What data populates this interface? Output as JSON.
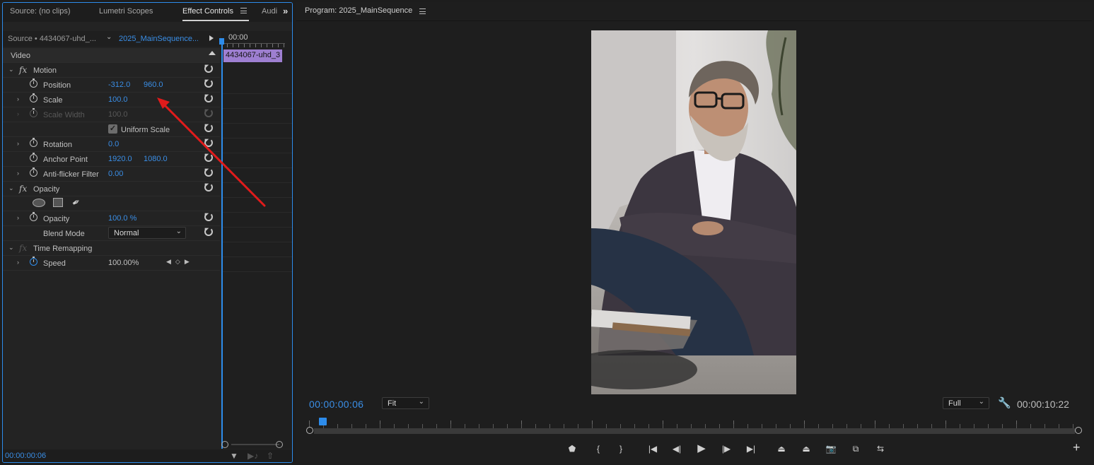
{
  "left_panel": {
    "tabs": [
      "Source: (no clips)",
      "Lumetri Scopes",
      "Effect Controls",
      "Audi"
    ],
    "active_tab": "Effect Controls",
    "source_label": "Source • 4434067-uhd_...",
    "sequence_link": "2025_MainSequence...",
    "timeline": {
      "time": "00:00",
      "clip_label": "4434067-uhd_3"
    },
    "section_video": "Video",
    "motion": {
      "label": "Motion",
      "position": {
        "label": "Position",
        "x": "-312.0",
        "y": "960.0"
      },
      "scale": {
        "label": "Scale",
        "value": "100.0"
      },
      "scale_width": {
        "label": "Scale Width",
        "value": "100.0"
      },
      "uniform_scale": {
        "label": "Uniform Scale",
        "checked": true
      },
      "rotation": {
        "label": "Rotation",
        "value": "0.0"
      },
      "anchor_point": {
        "label": "Anchor Point",
        "x": "1920.0",
        "y": "1080.0"
      },
      "anti_flicker": {
        "label": "Anti-flicker Filter",
        "value": "0.00"
      }
    },
    "opacity": {
      "label": "Opacity",
      "opacity_prop": {
        "label": "Opacity",
        "value": "100.0",
        "unit": "%"
      },
      "blend_mode": {
        "label": "Blend Mode",
        "value": "Normal"
      }
    },
    "time_remapping": {
      "label": "Time Remapping",
      "speed": {
        "label": "Speed",
        "value": "100.00%"
      }
    },
    "current_time": "00:00:00:06"
  },
  "program_monitor": {
    "title": "Program: 2025_MainSequence",
    "current_timecode": "00:00:00:06",
    "zoom": "Fit",
    "resolution": "Full",
    "duration": "00:00:10:22",
    "playhead_fraction": 0.009
  },
  "colors": {
    "accent": "#2d8ceb",
    "value_blue": "#3a8ee6",
    "clip_purple": "#9e7fd1",
    "annotation_arrow": "#e01b1b"
  }
}
